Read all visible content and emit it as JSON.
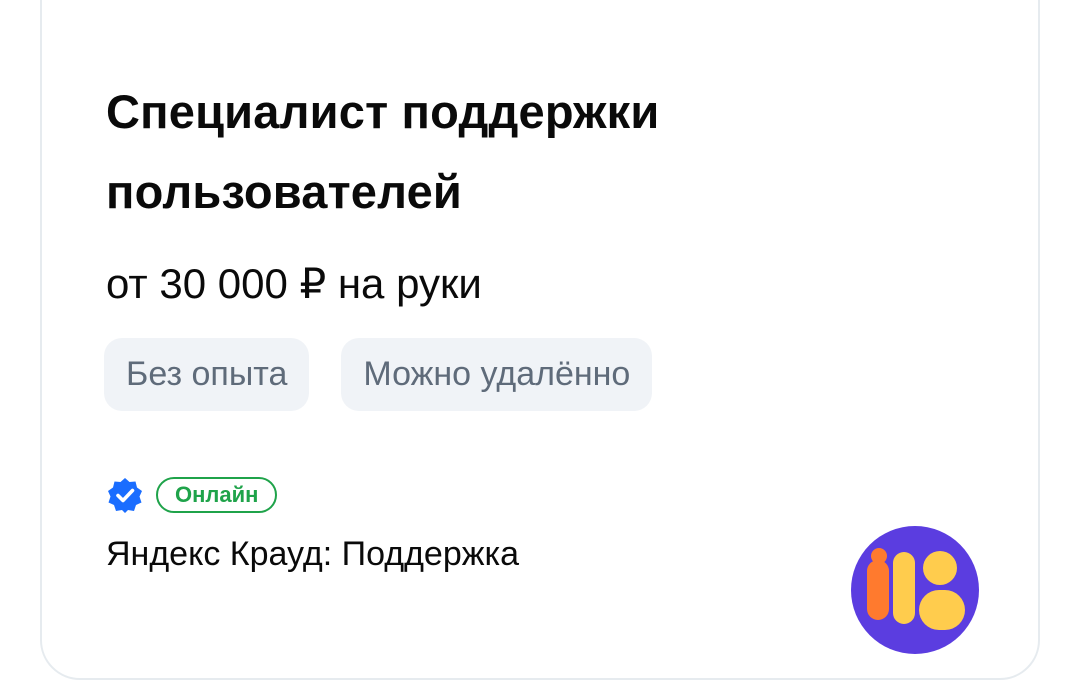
{
  "vacancy": {
    "title": "Специалист поддержки пользователей",
    "salary": "от 30 000 ₽ на руки",
    "tags": [
      "Без опыта",
      "Можно удалённо"
    ]
  },
  "employer": {
    "verified_icon": "verified-check-icon",
    "status_badge": "Онлайн",
    "name": "Яндекс Крауд: Поддержка",
    "logo_icon": "company-logo"
  },
  "colors": {
    "text": "#0a0a0a",
    "tag_bg": "#f0f3f7",
    "tag_text": "#5f6b7a",
    "verified": "#1a6dff",
    "online": "#1fa34a",
    "logo_bg": "#5b3de0",
    "logo_orange": "#ff7a2e",
    "logo_yellow": "#ffcc4d"
  }
}
